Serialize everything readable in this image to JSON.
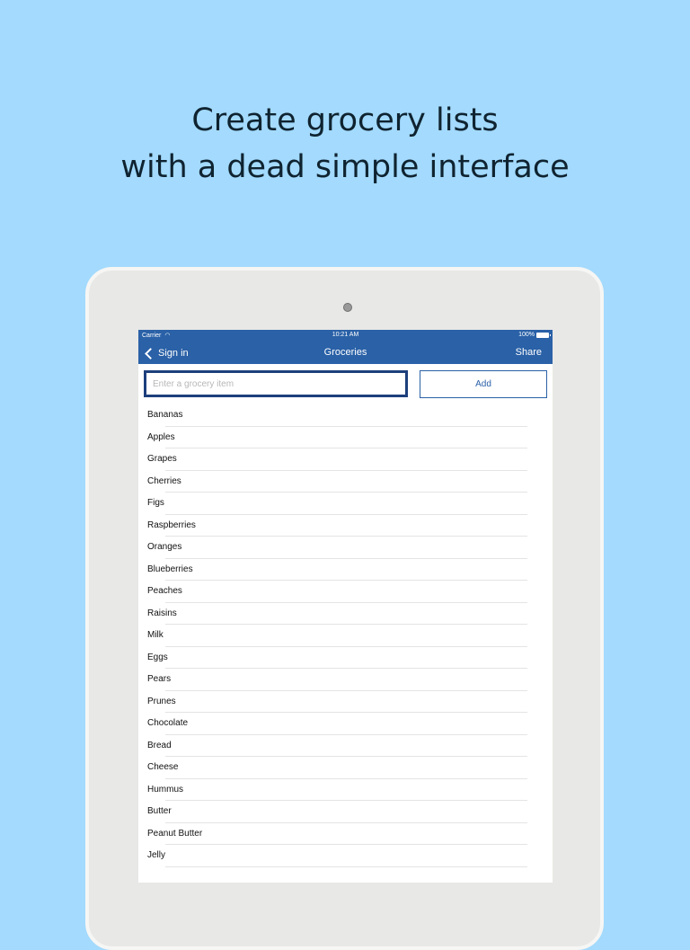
{
  "headline": {
    "line1": "Create grocery lists",
    "line2": "with a dead simple interface"
  },
  "status_bar": {
    "carrier": "Carrier",
    "time": "10:21 AM",
    "battery": "100%"
  },
  "nav": {
    "back_label": "Sign in",
    "title": "Groceries",
    "share_label": "Share"
  },
  "input": {
    "placeholder": "Enter a grocery item",
    "value": ""
  },
  "add_button": {
    "label": "Add"
  },
  "items": [
    "Bananas",
    "Apples",
    "Grapes",
    "Cherries",
    "Figs",
    "Raspberries",
    "Oranges",
    "Blueberries",
    "Peaches",
    "Raisins",
    "Milk",
    "Eggs",
    "Pears",
    "Prunes",
    "Chocolate",
    "Bread",
    "Cheese",
    "Hummus",
    "Butter",
    "Peanut Butter",
    "Jelly"
  ],
  "colors": {
    "background": "#a3dafd",
    "nav_bar": "#2a61a7",
    "input_border": "#1d3f7c",
    "accent": "#2a61a7"
  },
  "icons": [
    "wifi-icon",
    "battery-icon",
    "chevron-left-icon",
    "camera"
  ]
}
